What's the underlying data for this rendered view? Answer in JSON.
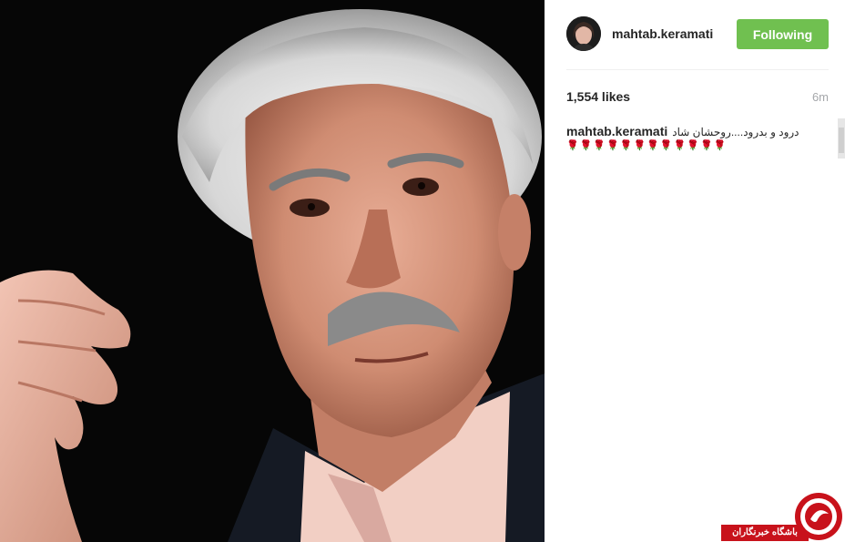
{
  "post": {
    "username": "mahtab.keramati",
    "follow_button_label": "Following",
    "likes": "1,554 likes",
    "time_ago": "6m",
    "caption": {
      "username": "mahtab.keramati",
      "text": "درود و بدرود....روحشان شاد",
      "emojis": "🌹🌹🌹🌹🌹🌹🌹🌹🌹🌹🌹🌹"
    }
  },
  "watermark": {
    "text": "باشگاه خبرنگاران"
  },
  "colors": {
    "follow_button": "#70c050",
    "watermark_red": "#c8121b",
    "text_primary": "#262626",
    "text_muted": "#a5a7aa"
  },
  "icons": {
    "avatar": "profile-avatar",
    "watermark_logo": "news-agency-logo"
  }
}
